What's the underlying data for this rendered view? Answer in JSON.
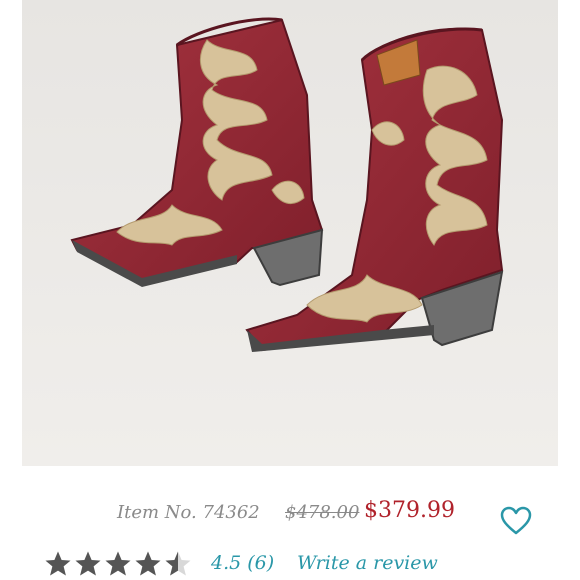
{
  "product": {
    "image_alt": "Red embroidered western boots",
    "item_number": "Item No. 74362",
    "original_price": "$478.00",
    "sale_price": "$379.99",
    "favorite_icon": "heart-outline-icon"
  },
  "rating": {
    "stars_value": 4.5,
    "stars_max": 5,
    "summary": "4.5 (6)",
    "write_review_label": "Write a review"
  },
  "colors": {
    "sale_price": "#b0222b",
    "link": "#2a97a8",
    "muted_text": "#8a8a8a",
    "star": "#555555"
  }
}
